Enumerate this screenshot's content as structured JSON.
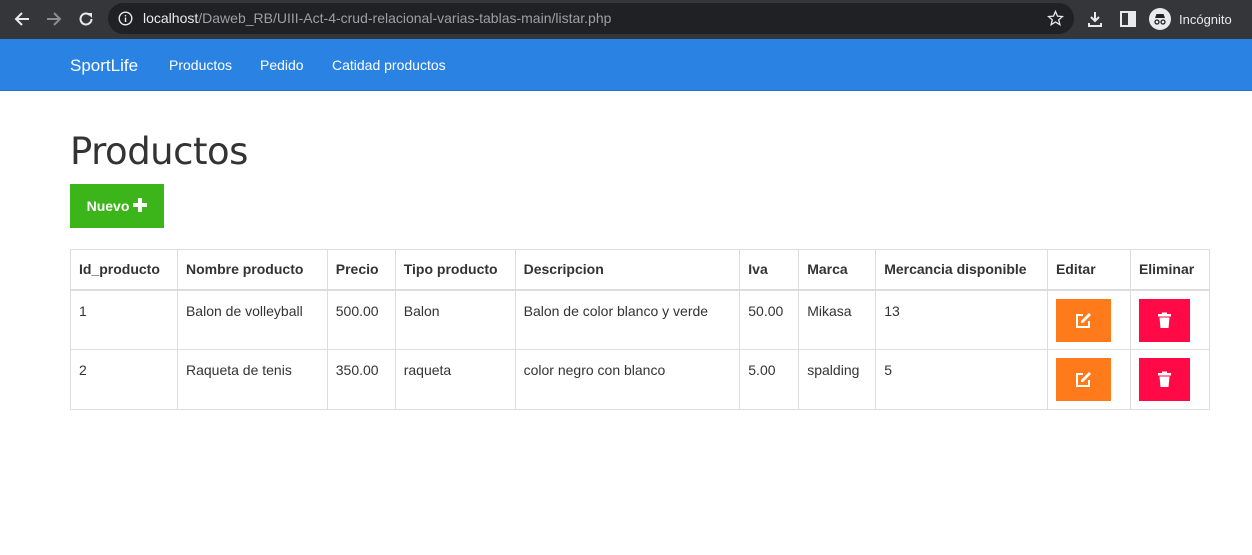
{
  "browser": {
    "url_host": "localhost",
    "url_path": "/Daweb_RB/UIII-Act-4-crud-relacional-varias-tablas-main/listar.php",
    "profile_label": "Incógnito"
  },
  "navbar": {
    "brand": "SportLife",
    "links": [
      "Productos",
      "Pedido",
      "Catidad productos"
    ]
  },
  "page": {
    "title": "Productos",
    "new_button": "Nuevo"
  },
  "table": {
    "headers": [
      "Id_producto",
      "Nombre producto",
      "Precio",
      "Tipo producto",
      "Descripcion",
      "Iva",
      "Marca",
      "Mercancia disponible",
      "Editar",
      "Eliminar"
    ],
    "rows": [
      [
        "1",
        "Balon de volleyball",
        "500.00",
        "Balon",
        "Balon de color blanco y verde",
        "50.00",
        "Mikasa",
        "13"
      ],
      [
        "2",
        "Raqueta de tenis",
        "350.00",
        "raqueta",
        "color negro con blanco",
        "5.00",
        "spalding",
        "5"
      ]
    ]
  },
  "colors": {
    "navbar": "#2a83e3",
    "new_button": "#3bb519",
    "edit_button": "#ff7a1a",
    "delete_button": "#ff0a47"
  },
  "icons": {
    "new": "plus-icon",
    "edit": "edit-icon",
    "delete": "trash-icon"
  }
}
